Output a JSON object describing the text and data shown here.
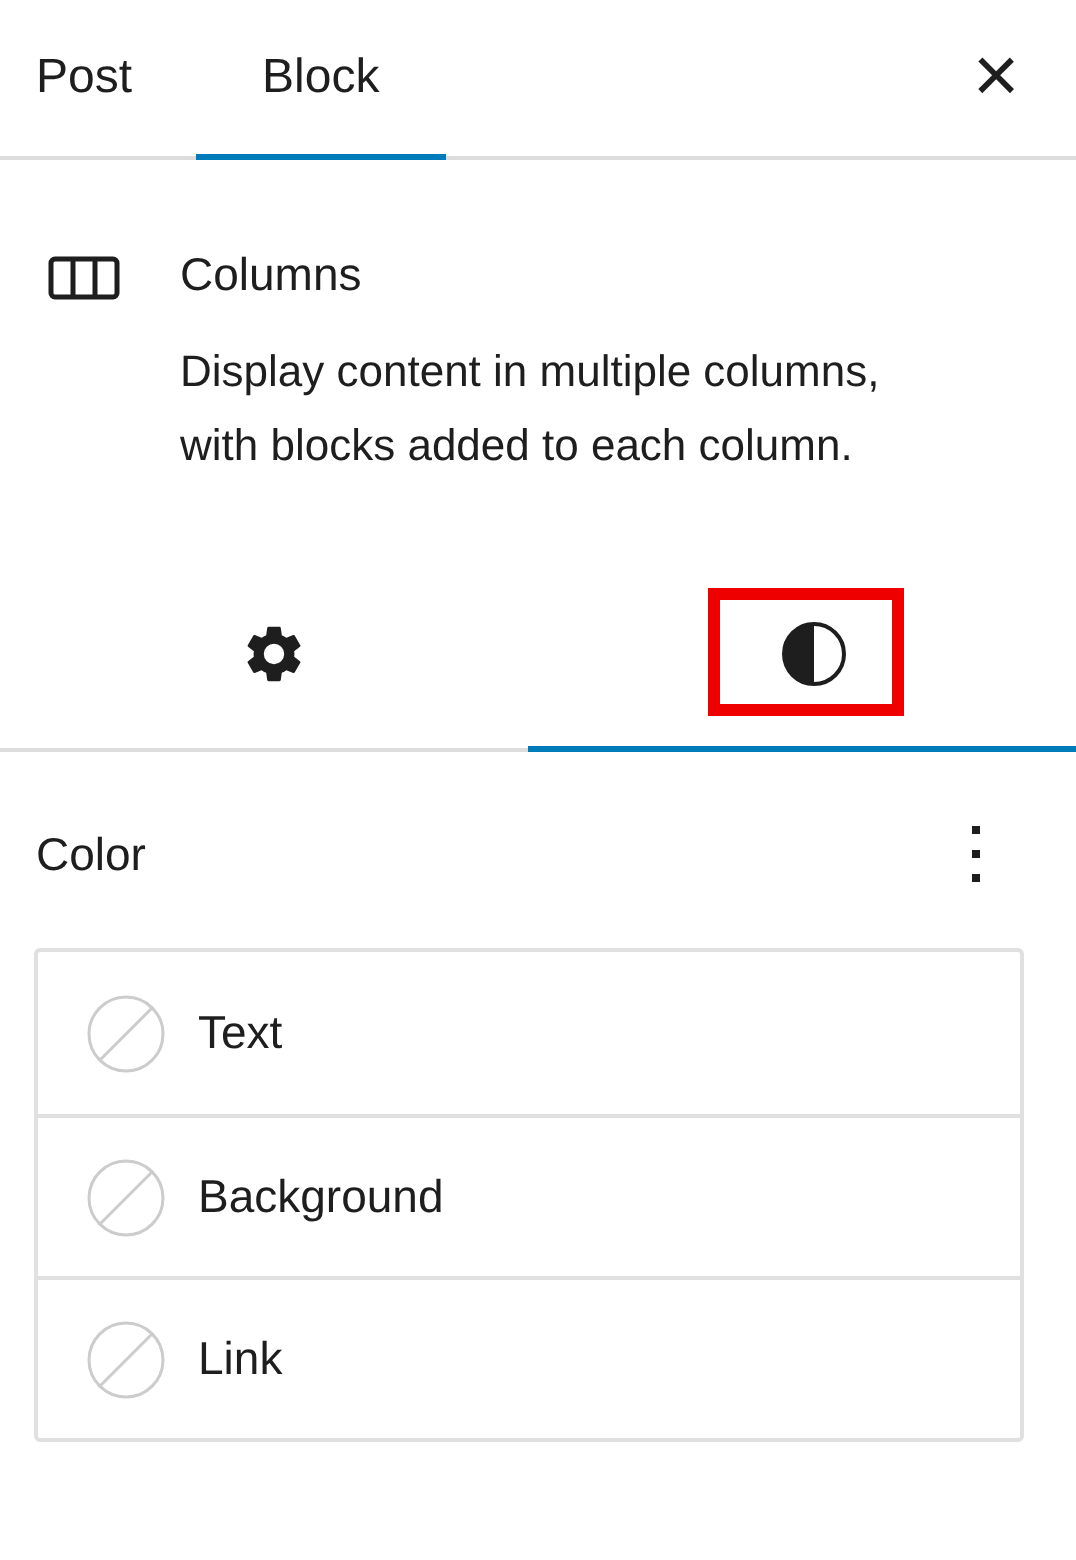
{
  "tabs": [
    {
      "label": "Post",
      "selected": false
    },
    {
      "label": "Block",
      "selected": true
    }
  ],
  "close": "×",
  "block": {
    "title": "Columns",
    "description": "Display content in multiple columns, with blocks added to each column."
  },
  "inspector_tabs": [
    {
      "kind": "settings",
      "selected": false,
      "highlighted": false
    },
    {
      "kind": "styles",
      "selected": true,
      "highlighted": true
    }
  ],
  "color_panel": {
    "title": "Color",
    "items": [
      {
        "label": "Text"
      },
      {
        "label": "Background"
      },
      {
        "label": "Link"
      }
    ]
  }
}
